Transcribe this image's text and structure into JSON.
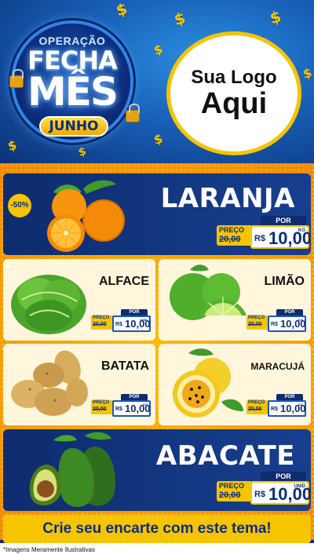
{
  "header": {
    "campaign_line1": "OPERAÇÃO",
    "campaign_line2": "FECHA",
    "campaign_line3": "MÊS",
    "campaign_month": "JUNHO",
    "logo_line1": "Sua Logo",
    "logo_line2": "Aqui",
    "decor_symbol": "$"
  },
  "colors": {
    "navy": "#0e2c6e",
    "yellow": "#f6c400",
    "orange": "#f79a00",
    "sky": "#1860b8",
    "card": "#fff6dc"
  },
  "price_labels": {
    "por": "POR",
    "preco": "PREÇO",
    "currency": "R$"
  },
  "products": {
    "laranja": {
      "name": "LARANJA",
      "discount": "-50%",
      "old_price": "20,00",
      "price": "10,00",
      "unit": "KG"
    },
    "alface": {
      "name": "ALFACE",
      "old_price": "20,00",
      "price": "10,00",
      "unit": "UNID"
    },
    "limao": {
      "name": "LIMÃO",
      "old_price": "20,00",
      "price": "10,00",
      "unit": "KG"
    },
    "batata": {
      "name": "BATATA",
      "old_price": "20,00",
      "price": "10,00",
      "unit": "KG"
    },
    "maracuja": {
      "name": "MARACUJÁ",
      "old_price": "20,00",
      "price": "10,00",
      "unit": "KG"
    },
    "abacate": {
      "name": "ABACATE",
      "old_price": "20,00",
      "price": "10,00",
      "unit": "UNID"
    }
  },
  "banner": "Crie seu encarte com este tema!",
  "footnote": "*Imagens Meramente Ilustrativas"
}
